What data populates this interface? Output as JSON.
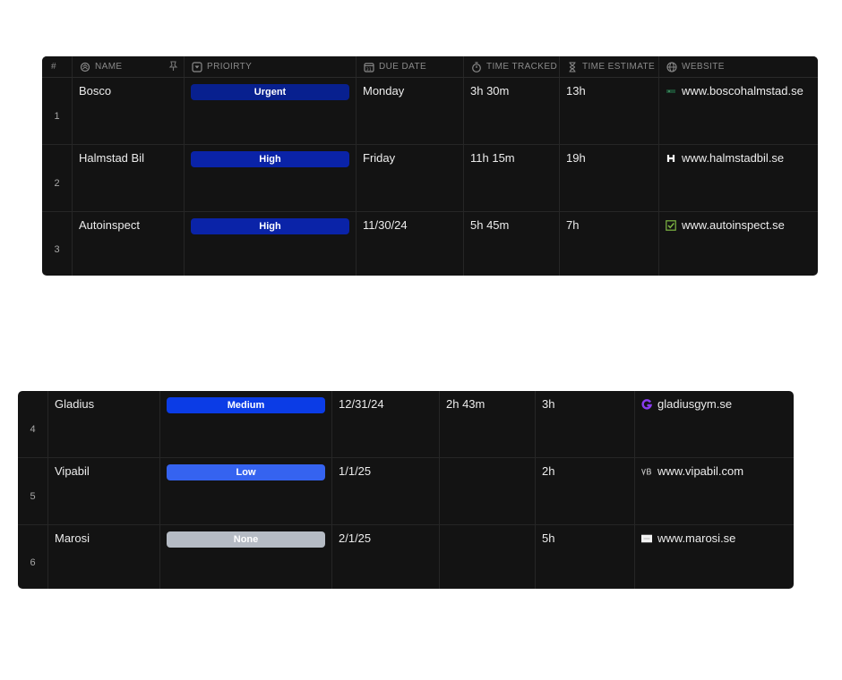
{
  "header": {
    "num": "#",
    "name": "NAME",
    "priority": "PRIOIRTY",
    "due_date": "DUE DATE",
    "time_tracked": "TIME TRACKED",
    "time_estimate": "TIME ESTIMATE",
    "website": "WEBSITE"
  },
  "priority_colors": {
    "Urgent": "#08208f",
    "High": "#0a23a8",
    "Medium": "#0b3ce6",
    "Low": "#3563f0",
    "None": "#b5bbc4"
  },
  "rows_top": [
    {
      "num": "1",
      "name": "Bosco",
      "priority": "Urgent",
      "due": "Monday",
      "tracked": "3h 30m",
      "estimate": "13h",
      "website": "www.boscohalmstad.se",
      "favicon": "bosco-logo-icon"
    },
    {
      "num": "2",
      "name": "Halmstad Bil",
      "priority": "High",
      "due": "Friday",
      "tracked": "11h 15m",
      "estimate": "19h",
      "website": "www.halmstadbil.se",
      "favicon": "h-logo-icon"
    },
    {
      "num": "3",
      "name": "Autoinspect",
      "priority": "High",
      "due": "11/30/24",
      "tracked": "5h 45m",
      "estimate": "7h",
      "website": "www.autoinspect.se",
      "favicon": "checkbox-logo-icon"
    }
  ],
  "rows_bottom": [
    {
      "num": "4",
      "name": "Gladius",
      "priority": "Medium",
      "due": "12/31/24",
      "tracked": "2h 43m",
      "estimate": "3h",
      "website": "gladiusgym.se",
      "favicon": "g-logo-icon"
    },
    {
      "num": "5",
      "name": "Vipabil",
      "priority": "Low",
      "due": "1/1/25",
      "tracked": "",
      "estimate": "2h",
      "website": "www.vipabil.com",
      "favicon": "vb-logo-icon"
    },
    {
      "num": "6",
      "name": "Marosi",
      "priority": "None",
      "due": "2/1/25",
      "tracked": "",
      "estimate": "5h",
      "website": "www.marosi.se",
      "favicon": "marosi-logo-icon"
    }
  ]
}
